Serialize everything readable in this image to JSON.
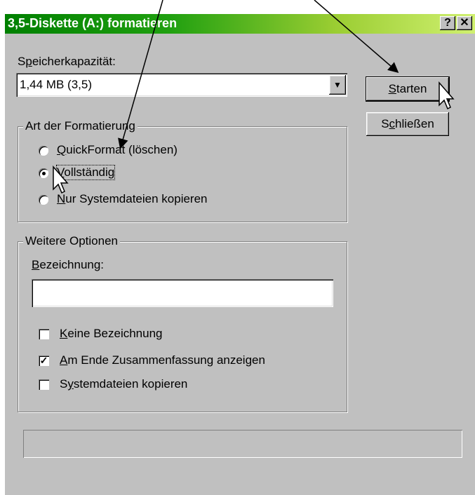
{
  "window": {
    "title": "3,5-Diskette (A:) formatieren",
    "help_glyph": "?",
    "close_glyph": "✕"
  },
  "capacity": {
    "label_prefix": "S",
    "label_mnemonic": "p",
    "label_rest": "eicherkapazität:",
    "selected": "1,44 MB (3,5)",
    "dropdown_glyph": "▼"
  },
  "format_type": {
    "legend": "Art der Formatierung",
    "options": [
      {
        "mnemonic": "Q",
        "rest": "uickFormat (löschen)",
        "selected": false
      },
      {
        "mnemonic": "V",
        "rest": "ollständig",
        "selected": true
      },
      {
        "mnemonic": "N",
        "rest": "ur Systemdateien kopieren",
        "selected": false
      }
    ]
  },
  "more_options": {
    "legend": "Weitere Optionen",
    "label_mnemonic": "B",
    "label_rest": "ezeichnung:",
    "label_value": "",
    "checkboxes": [
      {
        "mnemonic": "K",
        "rest": "eine Bezeichnung",
        "checked": false
      },
      {
        "mnemonic": "A",
        "rest": "m Ende Zusammenfassung anzeigen",
        "checked": true
      },
      {
        "prefix": "S",
        "mnemonic": "y",
        "rest": "stemdateien kopieren",
        "checked": false
      }
    ]
  },
  "buttons": {
    "start": {
      "mnemonic": "S",
      "rest": "tarten"
    },
    "close": {
      "prefix": "S",
      "mnemonic": "c",
      "rest": "hließen"
    }
  },
  "check_glyph": "✓"
}
